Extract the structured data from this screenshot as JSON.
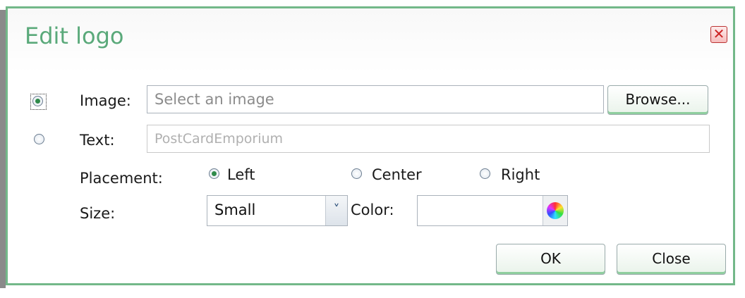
{
  "dialog": {
    "title": "Edit logo",
    "close_icon": "close-icon"
  },
  "source": {
    "image_label": "Image:",
    "image_placeholder": "Select an image",
    "browse_label": "Browse...",
    "text_label": "Text:",
    "text_value": "PostCardEmporium",
    "selected": "image"
  },
  "placement": {
    "label": "Placement:",
    "options": [
      "Left",
      "Center",
      "Right"
    ],
    "selected": "Left"
  },
  "size": {
    "label": "Size:",
    "value": "Small"
  },
  "color": {
    "label": "Color:",
    "value": ""
  },
  "buttons": {
    "ok": "OK",
    "close": "Close"
  },
  "colors": {
    "accent": "#73b889",
    "title": "#5aa97a"
  }
}
